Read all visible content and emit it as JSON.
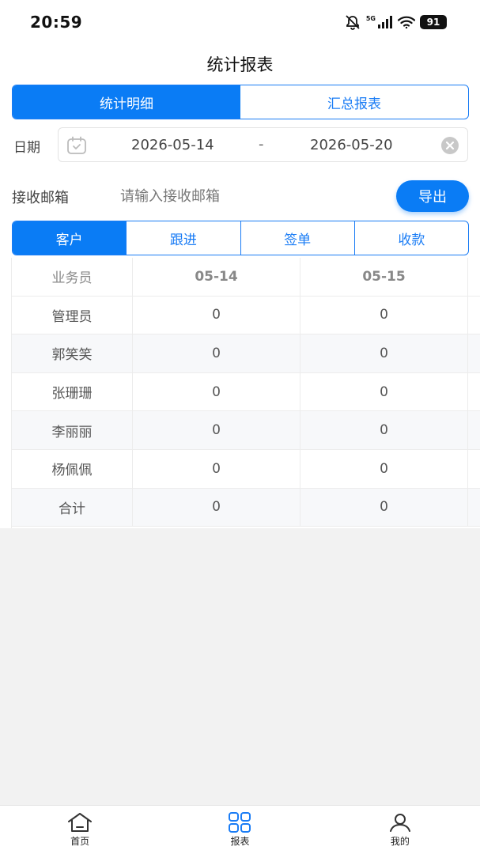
{
  "status_bar": {
    "time": "20:59",
    "battery": "91",
    "network": "5G"
  },
  "page_title": "统计报表",
  "top_segment": {
    "items": [
      "统计明细",
      "汇总报表"
    ],
    "active_index": 0
  },
  "date_filter": {
    "label": "日期",
    "start": "2026-05-14",
    "separator": "-",
    "end": "2026-05-20"
  },
  "email": {
    "label": "接收邮箱",
    "placeholder": "请输入接收邮箱",
    "value": ""
  },
  "export_button": "导出",
  "category_tabs": {
    "items": [
      "客户",
      "跟进",
      "签单",
      "收款"
    ],
    "active_index": 0
  },
  "table": {
    "columns": [
      "业务员",
      "05-14",
      "05-15"
    ],
    "rows": [
      {
        "name": "管理员",
        "values": [
          "0",
          "0"
        ]
      },
      {
        "name": "郭笑笑",
        "values": [
          "0",
          "0"
        ]
      },
      {
        "name": "张珊珊",
        "values": [
          "0",
          "0"
        ]
      },
      {
        "name": "李丽丽",
        "values": [
          "0",
          "0"
        ]
      },
      {
        "name": "杨佩佩",
        "values": [
          "0",
          "0"
        ]
      },
      {
        "name": "合计",
        "values": [
          "0",
          "0"
        ]
      }
    ]
  },
  "bottom_nav": {
    "items": [
      {
        "label": "首页",
        "icon": "home-icon"
      },
      {
        "label": "报表",
        "icon": "grid-icon"
      },
      {
        "label": "我的",
        "icon": "user-icon"
      }
    ],
    "active_index": 1
  },
  "colors": {
    "accent": "#0a7cf5",
    "nav_active_icon": "#1a7cf5"
  }
}
